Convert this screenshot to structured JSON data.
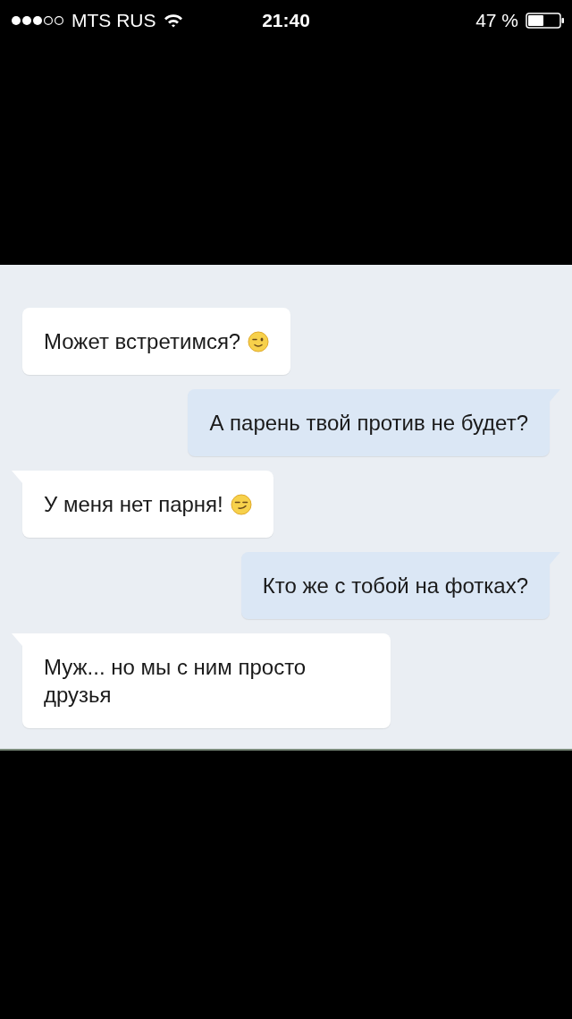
{
  "status_bar": {
    "carrier": "MTS RUS",
    "time": "21:40",
    "battery": "47 %"
  },
  "messages": [
    {
      "kind": "incoming",
      "text": "Может встретимся?",
      "tail": false,
      "emoji": {
        "kind": "wink"
      }
    },
    {
      "kind": "outgoing",
      "text": "А парень твой против не будет?",
      "tail": true
    },
    {
      "kind": "incoming",
      "text": "У меня нет парня!",
      "tail": true,
      "emoji": {
        "kind": "smirk"
      }
    },
    {
      "kind": "outgoing",
      "text": "Кто же с тобой на фотках?",
      "tail": true
    },
    {
      "kind": "incoming",
      "text": "Муж... но мы с ним просто друзья",
      "tail": true
    }
  ]
}
